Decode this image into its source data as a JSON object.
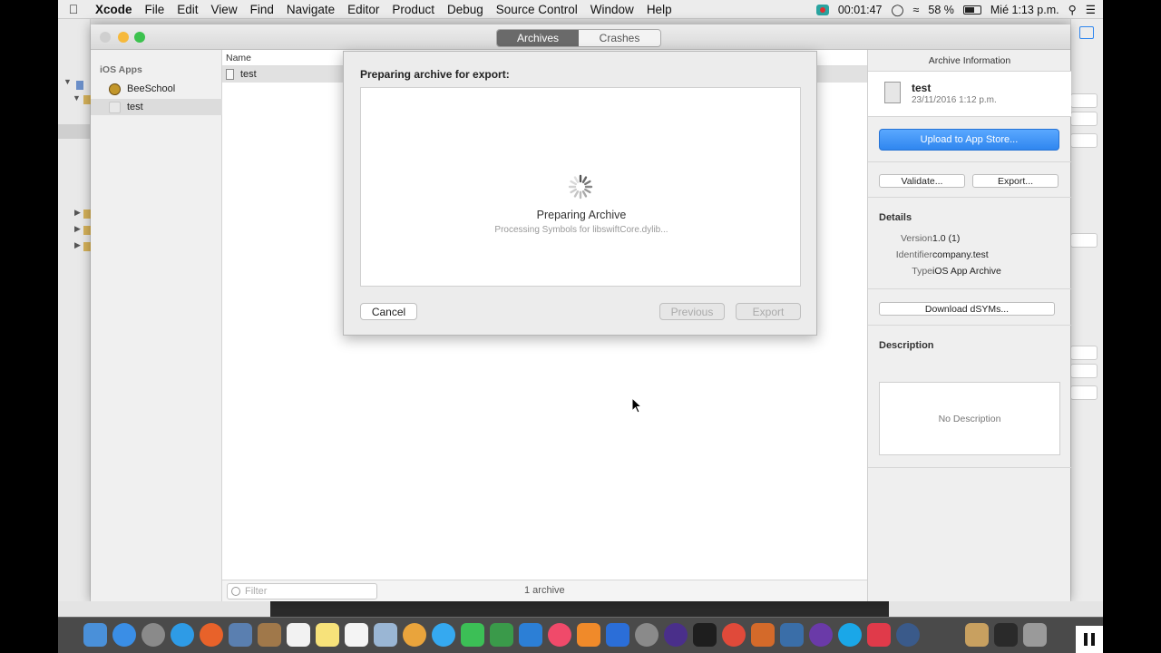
{
  "menubar": {
    "items": [
      "Xcode",
      "File",
      "Edit",
      "View",
      "Find",
      "Navigate",
      "Editor",
      "Product",
      "Debug",
      "Source Control",
      "Window",
      "Help"
    ],
    "timer": "00:01:47",
    "battery": "58 %",
    "clock": "Mié 1:13 p.m."
  },
  "organizer": {
    "tabs": {
      "archives": "Archives",
      "crashes": "Crashes"
    },
    "sidebar": {
      "group_label": "iOS Apps",
      "items": [
        {
          "label": "BeeSchool"
        },
        {
          "label": "test"
        }
      ]
    },
    "list": {
      "column_name": "Name",
      "rows": [
        {
          "name": "test"
        }
      ],
      "filter_placeholder": "Filter",
      "count": "1 archive"
    },
    "info": {
      "header": "Archive Information",
      "name": "test",
      "date": "23/11/2016 1:12 p.m.",
      "upload_label": "Upload to App Store...",
      "validate_label": "Validate...",
      "export_label": "Export...",
      "details_title": "Details",
      "details": [
        {
          "key": "Version",
          "value": "1.0 (1)"
        },
        {
          "key": "Identifier",
          "value": "company.test"
        },
        {
          "key": "Type",
          "value": "iOS App Archive"
        }
      ],
      "download_dsyms_label": "Download dSYMs...",
      "description_title": "Description",
      "description_placeholder": "No Description"
    }
  },
  "sheet": {
    "title": "Preparing archive for export:",
    "status_title": "Preparing Archive",
    "status_detail": "Processing Symbols for libswiftCore.dylib...",
    "cancel_label": "Cancel",
    "previous_label": "Previous",
    "export_label": "Export"
  },
  "colors": {
    "accent_blue": "#2f86ef",
    "dock_bg": "#4a4a4a"
  }
}
